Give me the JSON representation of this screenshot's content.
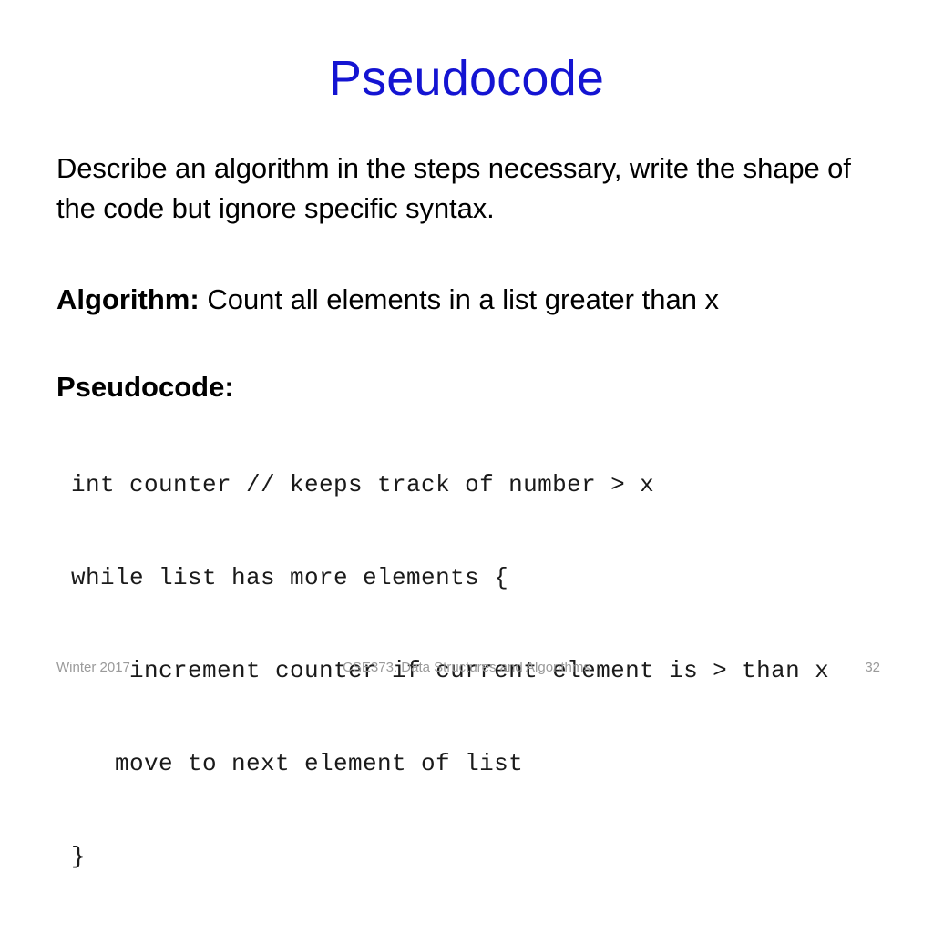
{
  "slide": {
    "title": "Pseudocode",
    "title_color": "#1414d2",
    "background_color": "#ffffff",
    "body_text_color": "#000000",
    "code_text_color": "#1a1a1a",
    "footer_text_color": "#9a9a9a"
  },
  "body": {
    "description": "Describe an algorithm in the steps necessary, write the shape of the code but ignore specific syntax.",
    "algorithm_label": "Algorithm:",
    "algorithm_text": " Count all elements in a list greater than x",
    "pseudocode_label": "Pseudocode:"
  },
  "code": {
    "lines": [
      "int counter // keeps track of number > x",
      "while list has more elements {",
      "    increment counter if current element is > than x",
      "   move to next element of list",
      "}"
    ]
  },
  "footer": {
    "left": "Winter 2017",
    "center": "CSE373: Data Structures and Algorithms",
    "page_number": "32"
  }
}
